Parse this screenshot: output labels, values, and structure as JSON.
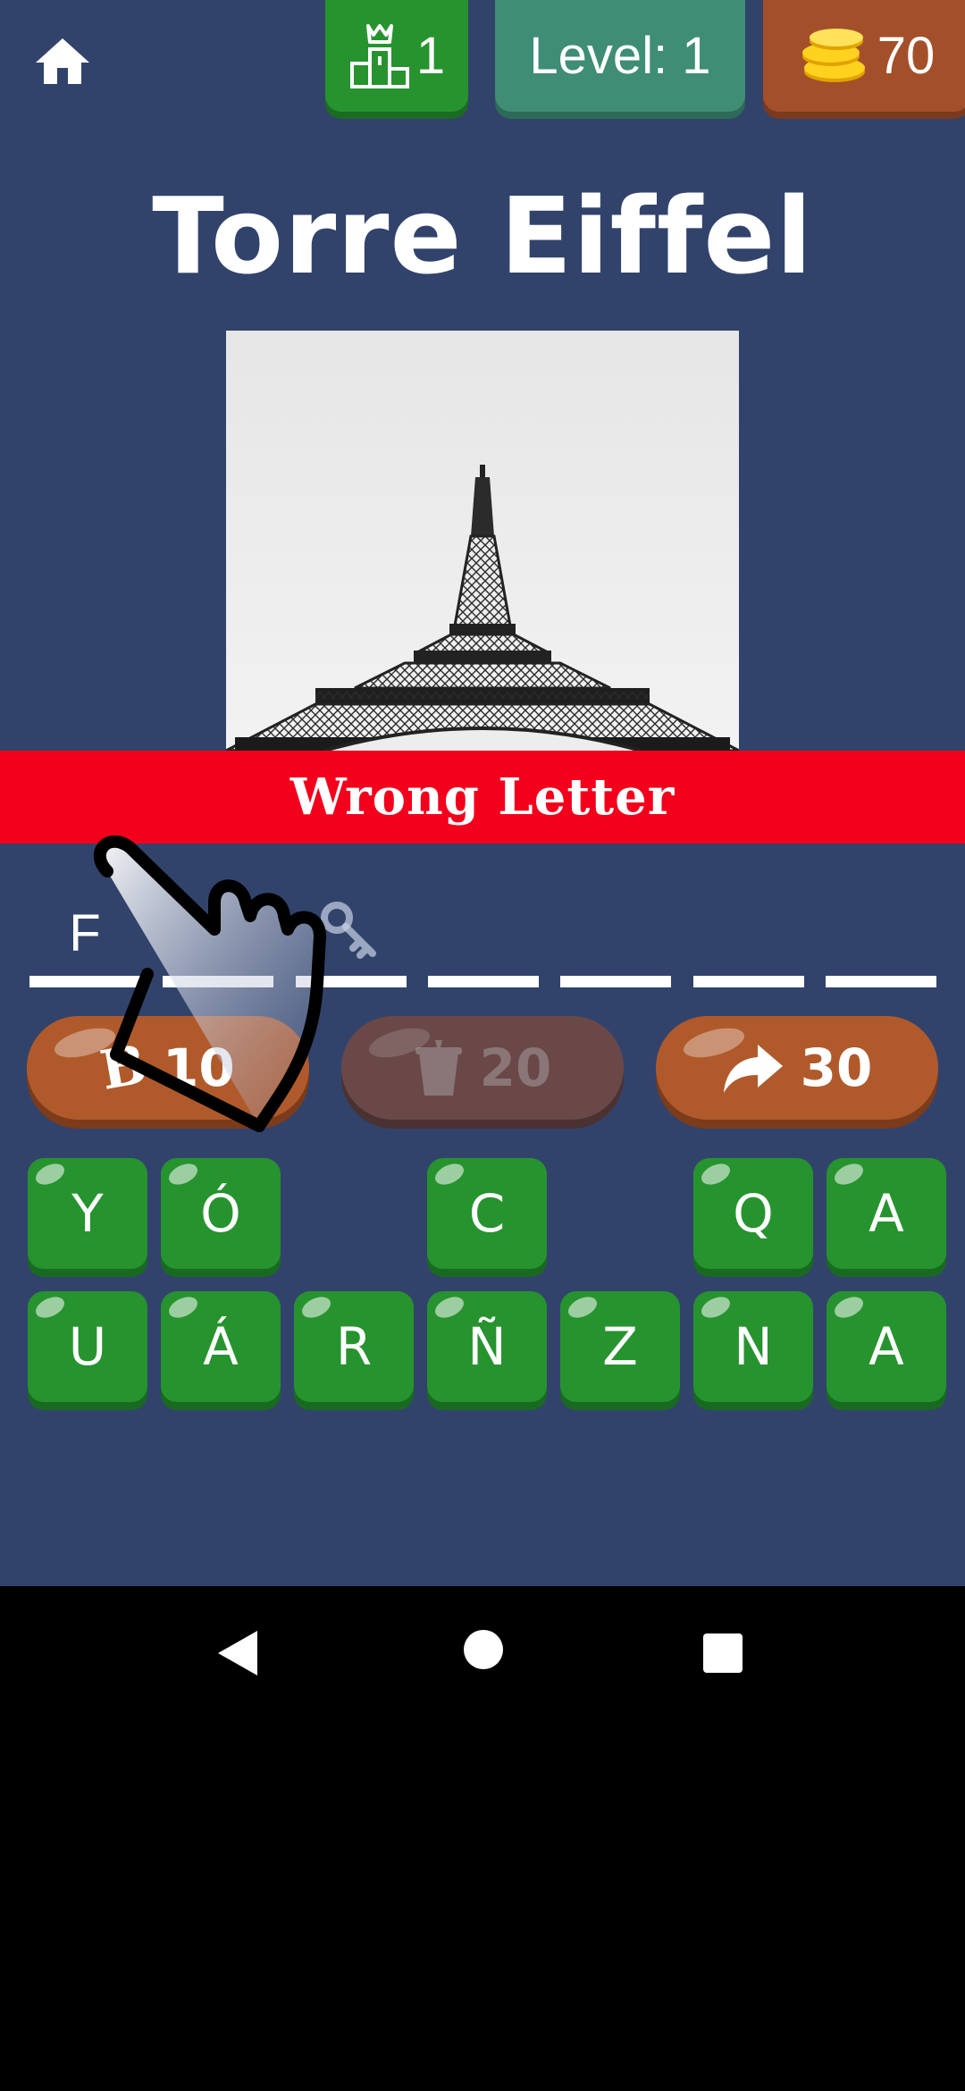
{
  "header": {
    "rank_value": "1",
    "level_label": "Level: 1",
    "coins_value": "70"
  },
  "title": "Torre Eiffel",
  "banner": "Wrong Letter",
  "answer_slots": [
    "F",
    "",
    "",
    "",
    "",
    "",
    "",
    ""
  ],
  "powerups": [
    {
      "label": "B",
      "cost": "10",
      "icon": "bomb-icon"
    },
    {
      "label": "",
      "cost": "20",
      "icon": "trash-icon"
    },
    {
      "label": "",
      "cost": "30",
      "icon": "share-arrow-icon"
    }
  ],
  "keyboard": {
    "row1": [
      "Y",
      "Ó",
      "",
      "C",
      "",
      "Q",
      "A"
    ],
    "row2": [
      "U",
      "Á",
      "R",
      "Ñ",
      "Z",
      "N",
      "A"
    ]
  },
  "colors": {
    "background": "#32436b",
    "banner": "#f2001c",
    "key_green": "#26932f",
    "level_chip": "#3e8d74",
    "coins_chip": "#a3502a"
  }
}
